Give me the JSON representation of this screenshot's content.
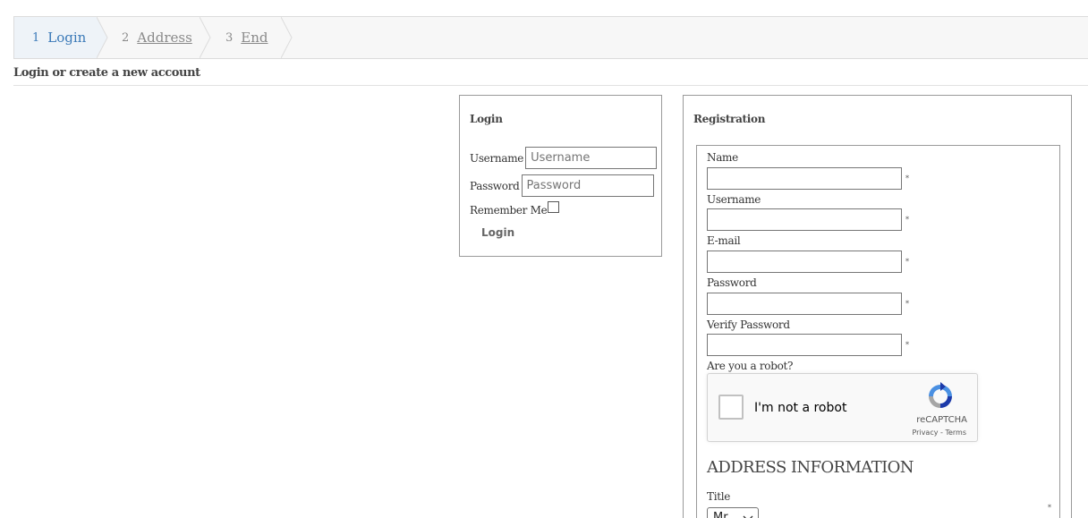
{
  "steps": [
    {
      "num": "1",
      "label": "Login"
    },
    {
      "num": "2",
      "label": "Address"
    },
    {
      "num": "3",
      "label": "End"
    }
  ],
  "page_title": "Login or create a new account",
  "login": {
    "heading": "Login",
    "username_label": "Username",
    "username_placeholder": "Username",
    "password_label": "Password",
    "password_placeholder": "Password",
    "remember_label": "Remember Me",
    "button": "Login"
  },
  "registration": {
    "heading": "Registration",
    "fields": [
      {
        "label": "Name",
        "required": "*"
      },
      {
        "label": "Username",
        "required": "*"
      },
      {
        "label": "E-mail",
        "required": "*"
      },
      {
        "label": "Password",
        "required": "*"
      },
      {
        "label": "Verify Password",
        "required": "*"
      }
    ],
    "robot_label": "Are you a robot?",
    "recaptcha": {
      "text": "I'm not a robot",
      "brand": "reCAPTCHA",
      "links": "Privacy - Terms"
    },
    "address_heading": "ADDRESS INFORMATION",
    "title_label": "Title",
    "title_value": "Mr",
    "title_required": "*"
  },
  "colors": {
    "active_step": "#3b7ab8",
    "inactive_step": "#8a8a8a",
    "border": "#9a9a9a"
  }
}
